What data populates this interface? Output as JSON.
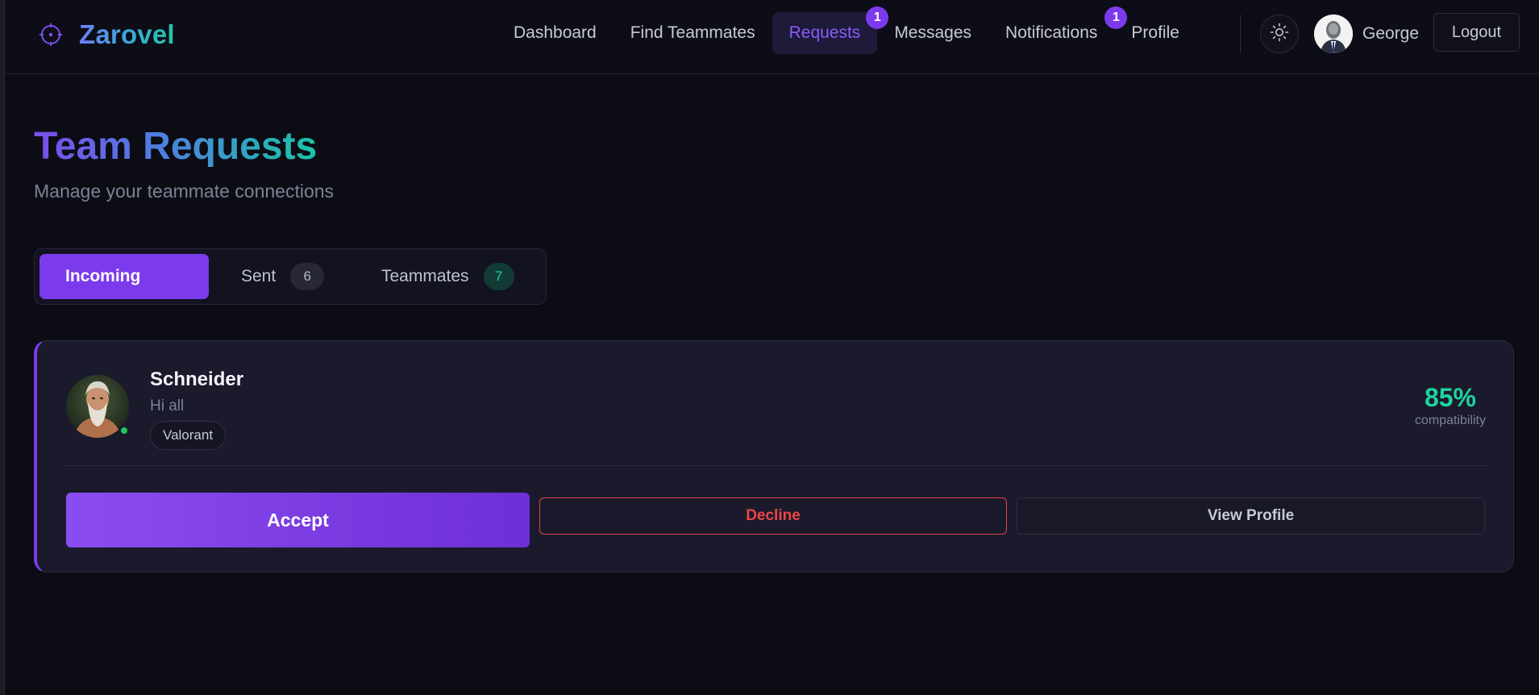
{
  "app": {
    "name": "Zarovel"
  },
  "nav": {
    "links": [
      {
        "label": "Dashboard"
      },
      {
        "label": "Find Teammates"
      },
      {
        "label": "Requests",
        "badge": "1",
        "active": true
      },
      {
        "label": "Messages"
      },
      {
        "label": "Notifications",
        "badge": "1"
      },
      {
        "label": "Profile"
      }
    ],
    "theme_icon": "sun-icon",
    "user_name": "George",
    "logout_label": "Logout"
  },
  "header": {
    "title": "Team Requests",
    "subtitle": "Manage your teammate connections"
  },
  "tabs": [
    {
      "label": "Incoming",
      "active": true
    },
    {
      "label": "Sent",
      "count": "6"
    },
    {
      "label": "Teammates",
      "count": "7"
    }
  ],
  "request": {
    "name": "Schneider",
    "message": "Hi all",
    "game": "Valorant",
    "compatibility": "85%",
    "compatibility_label": "compatibility",
    "status": "online",
    "accept_label": "Accept",
    "decline_label": "Decline",
    "view_label": "View Profile"
  },
  "colors": {
    "accent": "#7c3aed",
    "success": "#1ed3a0",
    "danger": "#ef4444",
    "background": "#0c0c15"
  }
}
